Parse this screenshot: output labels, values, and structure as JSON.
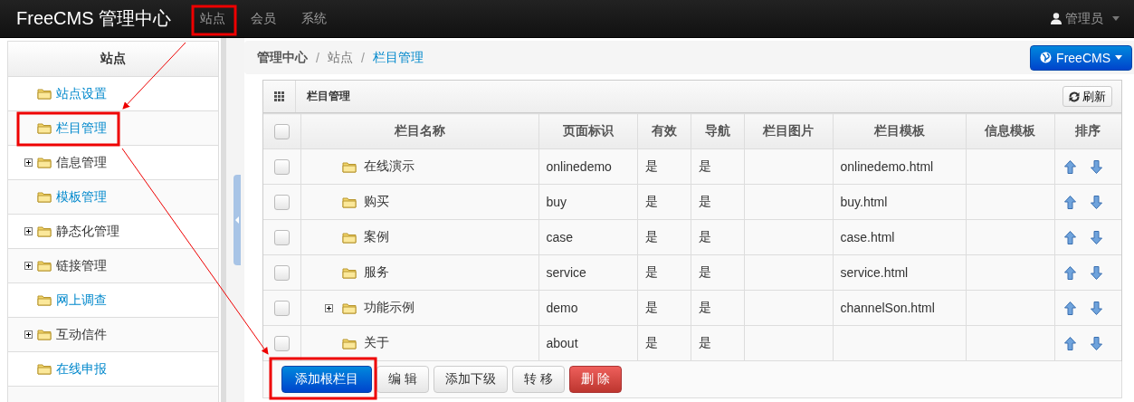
{
  "navbar": {
    "brand": "FreeCMS 管理中心",
    "items": [
      {
        "label": "站点"
      },
      {
        "label": "会员"
      },
      {
        "label": "系统"
      }
    ],
    "user": "管理员"
  },
  "sidebar": {
    "title": "站点",
    "items": [
      {
        "label": "站点设置",
        "expandable": false
      },
      {
        "label": "栏目管理",
        "expandable": false
      },
      {
        "label": "信息管理",
        "expandable": true
      },
      {
        "label": "模板管理",
        "expandable": false
      },
      {
        "label": "静态化管理",
        "expandable": true
      },
      {
        "label": "链接管理",
        "expandable": true
      },
      {
        "label": "网上调查",
        "expandable": false
      },
      {
        "label": "互动信件",
        "expandable": true
      },
      {
        "label": "在线申报",
        "expandable": false
      }
    ]
  },
  "breadcrumb": [
    {
      "text": "管理中心",
      "kind": "root"
    },
    {
      "text": "/",
      "kind": "sep"
    },
    {
      "text": "站点",
      "kind": "link"
    },
    {
      "text": "/",
      "kind": "sep"
    },
    {
      "text": "栏目管理",
      "kind": "current"
    }
  ],
  "site_button": "FreeCMS",
  "panel": {
    "title": "栏目管理",
    "refresh": "刷新",
    "table": {
      "columns": [
        "栏目名称",
        "页面标识",
        "有效",
        "导航",
        "栏目图片",
        "栏目模板",
        "信息模板",
        "排序"
      ],
      "header_checked": false,
      "rows": [
        {
          "checked": false,
          "expandable": false,
          "name": "在线演示",
          "page_id": "onlinedemo",
          "valid": "是",
          "nav": "是",
          "template": "onlinedemo.html"
        },
        {
          "checked": false,
          "expandable": false,
          "name": "购买",
          "page_id": "buy",
          "valid": "是",
          "nav": "是",
          "template": "buy.html"
        },
        {
          "checked": false,
          "expandable": false,
          "name": "案例",
          "page_id": "case",
          "valid": "是",
          "nav": "是",
          "template": "case.html"
        },
        {
          "checked": false,
          "expandable": false,
          "name": "服务",
          "page_id": "service",
          "valid": "是",
          "nav": "是",
          "template": "service.html"
        },
        {
          "checked": false,
          "expandable": true,
          "name": "功能示例",
          "page_id": "demo",
          "valid": "是",
          "nav": "是",
          "template": "channelSon.html"
        },
        {
          "checked": false,
          "expandable": false,
          "name": "关于",
          "page_id": "about",
          "valid": "是",
          "nav": "是",
          "template": ""
        }
      ]
    },
    "buttons": [
      {
        "label": "添加根栏目",
        "kind": "primary"
      },
      {
        "label": "编 辑",
        "kind": "default"
      },
      {
        "label": "添加下级",
        "kind": "default"
      },
      {
        "label": "转 移",
        "kind": "default"
      },
      {
        "label": "删 除",
        "kind": "danger"
      }
    ]
  }
}
